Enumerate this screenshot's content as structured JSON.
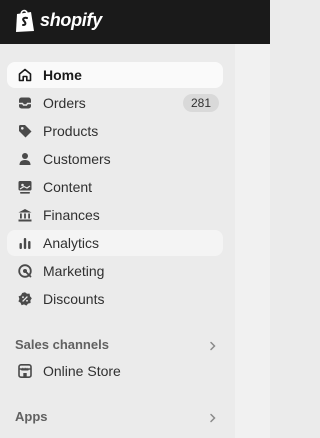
{
  "app": {
    "brand": "shopify"
  },
  "nav": {
    "items": [
      {
        "label": "Home",
        "icon": "home-icon"
      },
      {
        "label": "Orders",
        "icon": "orders-icon",
        "badge": "281"
      },
      {
        "label": "Products",
        "icon": "tag-icon"
      },
      {
        "label": "Customers",
        "icon": "person-icon"
      },
      {
        "label": "Content",
        "icon": "content-icon"
      },
      {
        "label": "Finances",
        "icon": "bank-icon"
      },
      {
        "label": "Analytics",
        "icon": "bar-chart-icon"
      },
      {
        "label": "Marketing",
        "icon": "target-icon"
      },
      {
        "label": "Discounts",
        "icon": "discount-icon"
      }
    ]
  },
  "sales_channels": {
    "title": "Sales channels",
    "items": [
      {
        "label": "Online Store",
        "icon": "store-icon"
      }
    ]
  },
  "apps": {
    "title": "Apps"
  },
  "colors": {
    "topbar": "#1a1a1a",
    "sidebar": "#ebebeb",
    "active_item": "#fafafa",
    "text": "#303030"
  }
}
